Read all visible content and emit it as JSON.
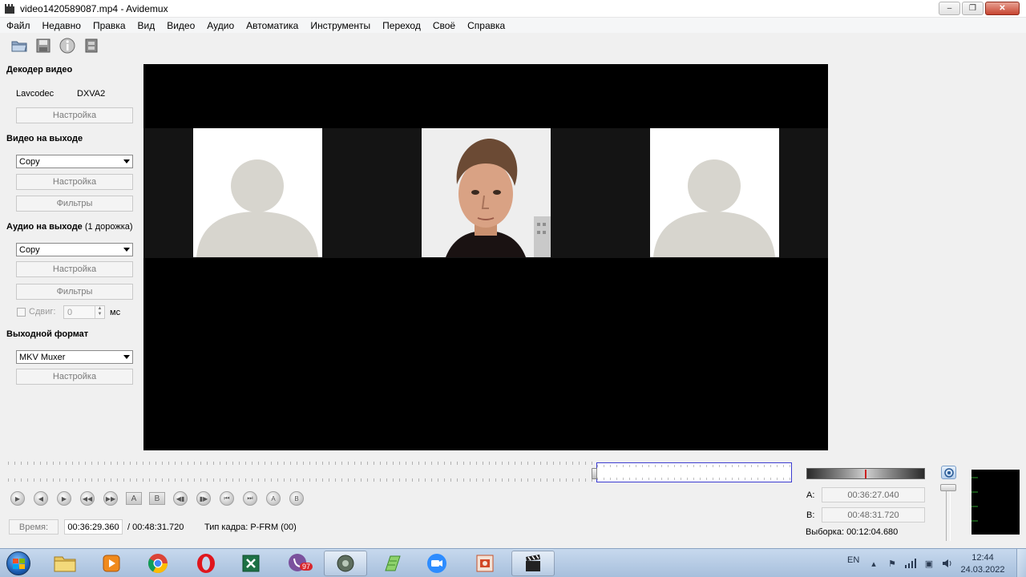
{
  "window": {
    "title": "video1420589087.mp4 - Avidemux",
    "minimize": "–",
    "maximize": "❐",
    "close": "✕"
  },
  "menu": [
    "Файл",
    "Недавно",
    "Правка",
    "Вид",
    "Видео",
    "Аудио",
    "Автоматика",
    "Инструменты",
    "Переход",
    "Своё",
    "Справка"
  ],
  "toolbar": {
    "icons": [
      "open-folder-icon",
      "save-disk-icon",
      "info-icon",
      "film-properties-icon"
    ]
  },
  "left_panel": {
    "video_decoder": {
      "title": "Декодер видео",
      "decoder": "Lavcodec",
      "hw": "DXVA2",
      "settings": "Настройка"
    },
    "video_output": {
      "title": "Видео на выходе",
      "codec": "Copy",
      "settings": "Настройка",
      "filters": "Фильтры"
    },
    "audio_output": {
      "title": "Аудио на выходе",
      "tracks": "(1 дорожка)",
      "codec": "Copy",
      "settings": "Настройка",
      "filters": "Фильтры",
      "shift_label": "Сдвиг:",
      "shift_value": "0",
      "shift_unit": "мс"
    },
    "output_format": {
      "title": "Выходной формат",
      "muxer": "MKV Muxer",
      "settings": "Настройка"
    }
  },
  "navigation": {
    "buttons": [
      "play-icon",
      "prev-frame-icon",
      "next-frame-icon",
      "prev-keyframe-icon",
      "next-keyframe-icon",
      "set-marker-a-icon",
      "set-marker-b-icon",
      "prev-black-frame-icon",
      "next-black-frame-icon",
      "goto-start-icon",
      "goto-end-icon",
      "goto-marker-a-icon",
      "goto-marker-b-icon"
    ],
    "labels": [
      "",
      "",
      "",
      "",
      "",
      "A",
      "B",
      "",
      "",
      "",
      "",
      "",
      ""
    ]
  },
  "status": {
    "time_label": "Время:",
    "current_time": "00:36:29.360",
    "total_time": "/ 00:48:31.720",
    "frame_type": "Тип кадра:  P-FRM (00)"
  },
  "selection": {
    "a_label": "A:",
    "a_time": "00:36:27.040",
    "b_label": "B:",
    "b_time": "00:48:31.720",
    "selection_text": "Выборка: 00:12:04.680",
    "position_fraction": 0.752
  },
  "taskbar": {
    "apps": [
      "explorer-icon",
      "media-player-icon",
      "chrome-icon",
      "opera-icon",
      "excel-icon",
      "viber-icon",
      "settings-gear-icon",
      "notepad-green-icon",
      "zoom-icon",
      "powerpoint-icon",
      "avidemux-icon"
    ],
    "viber_badge": "97",
    "language": "EN",
    "time": "12:44",
    "date": "24.03.2022"
  },
  "colors": {
    "video_bg": "#000000",
    "strip_bg": "#141414",
    "avatar_bg": "#d7d5ce",
    "selection_border": "#3a3ad0",
    "taskbar_top": "#c7d9ee"
  }
}
